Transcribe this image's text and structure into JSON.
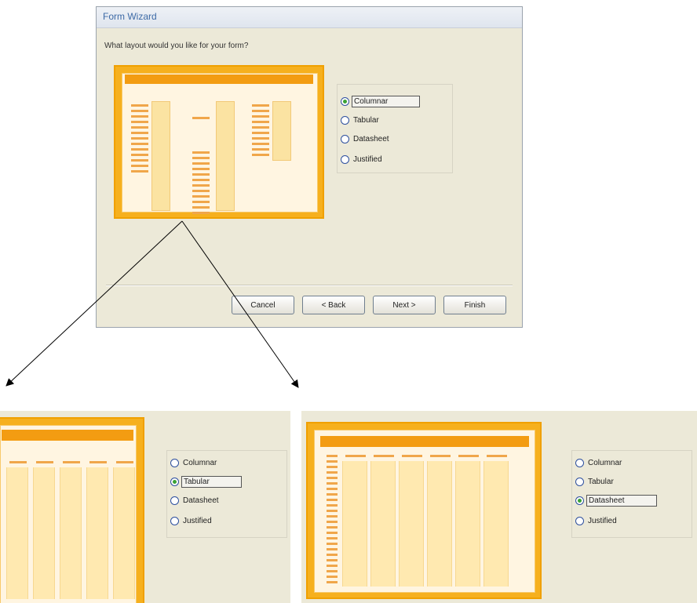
{
  "wizard": {
    "title": "Form Wizard",
    "prompt": "What layout would you like for your form?",
    "options": [
      "Columnar",
      "Tabular",
      "Datasheet",
      "Justified"
    ],
    "selected": "Columnar",
    "buttons": {
      "cancel": "Cancel",
      "back": "< Back",
      "next": "Next >",
      "finish": "Finish"
    }
  },
  "zoom_left": {
    "options": [
      "Columnar",
      "Tabular",
      "Datasheet",
      "Justified"
    ],
    "selected": "Tabular"
  },
  "zoom_right": {
    "options": [
      "Columnar",
      "Tabular",
      "Datasheet",
      "Justified"
    ],
    "selected": "Datasheet"
  },
  "colors": {
    "preview_border": "#f6b01e",
    "preview_header": "#f39c12",
    "dialog_bg": "#ece9d8"
  }
}
